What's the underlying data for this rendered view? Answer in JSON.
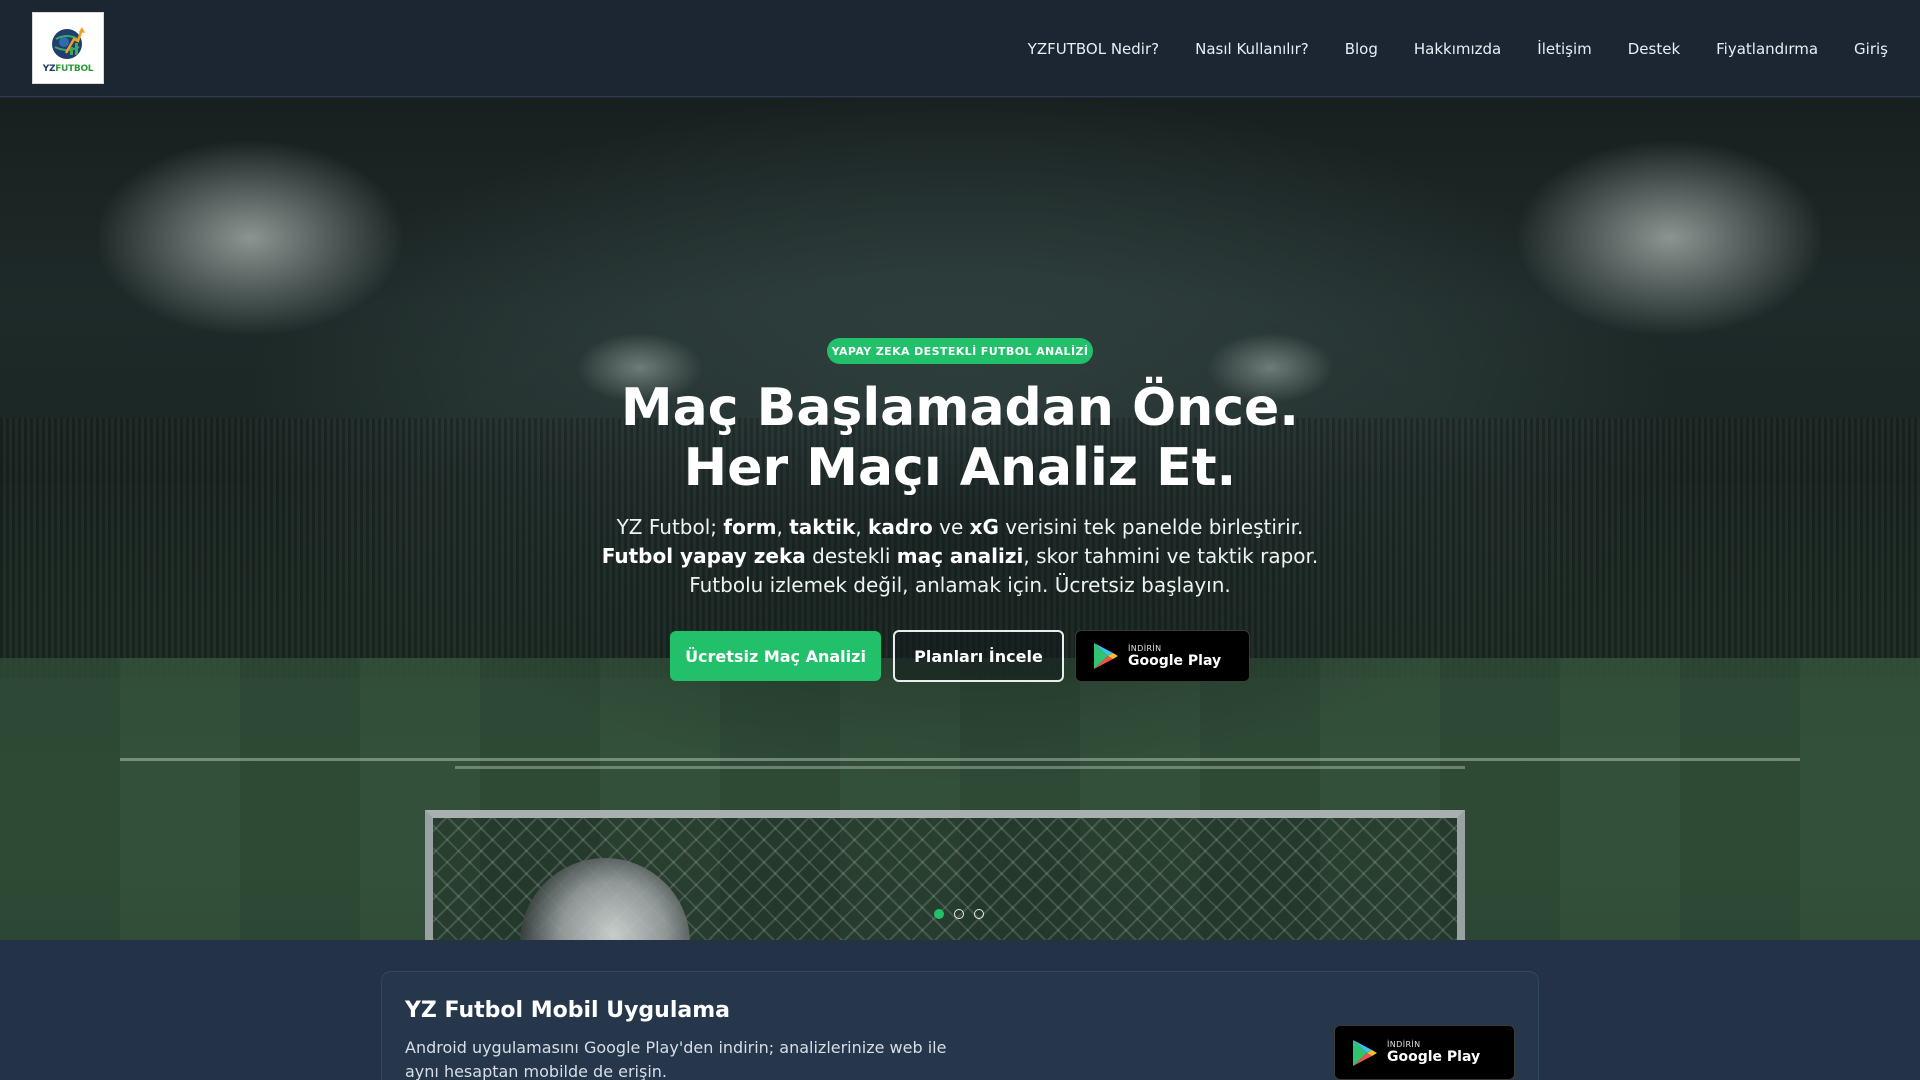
{
  "header": {
    "logo_text_a": "YZ",
    "logo_text_b": "FUTBOL",
    "nav": [
      "YZFUTBOL Nedir?",
      "Nasıl Kullanılır?",
      "Blog",
      "Hakkımızda",
      "İletişim",
      "Destek",
      "Fiyatlandırma",
      "Giriş"
    ]
  },
  "hero": {
    "badge": "YAPAY ZEKA DESTEKLİ FUTBOL ANALİZİ",
    "headline_line1": "Maç Başlamadan Önce.",
    "headline_line2": "Her Maçı Analiz Et.",
    "sub": {
      "l1_a": "YZ Futbol; ",
      "l1_b": "form",
      "l1_c": ", ",
      "l1_d": "taktik",
      "l1_e": ", ",
      "l1_f": "kadro",
      "l1_g": " ve ",
      "l1_h": "xG",
      "l1_i": " verisini tek panelde birleştirir.",
      "l2_a": "Futbol yapay zeka",
      "l2_b": " destekli ",
      "l2_c": "maç analizi",
      "l2_d": ", skor tahmini ve taktik rapor.",
      "l3": "Futbolu izlemek değil, anlamak için. Ücretsiz başlayın."
    },
    "btn_primary": "Ücretsiz Maç Analizi",
    "btn_secondary": "Planları İncele",
    "gplay_small": "İNDİRİN",
    "gplay_big": "Google Play",
    "slides_active": 0
  },
  "mobile_card": {
    "title": "YZ Futbol Mobil Uygulama",
    "text": "Android uygulamasını Google Play'den indirin; analizlerinize web ile aynı hesaptan mobilde de erişin.",
    "gplay_small": "İNDİRİN",
    "gplay_big": "Google Play"
  },
  "colors": {
    "accent": "#22c06a",
    "header_bg": "#1c2532",
    "section_bg": "#233246"
  },
  "icons": [
    "yzfutbol-logo",
    "google-play-icon"
  ]
}
